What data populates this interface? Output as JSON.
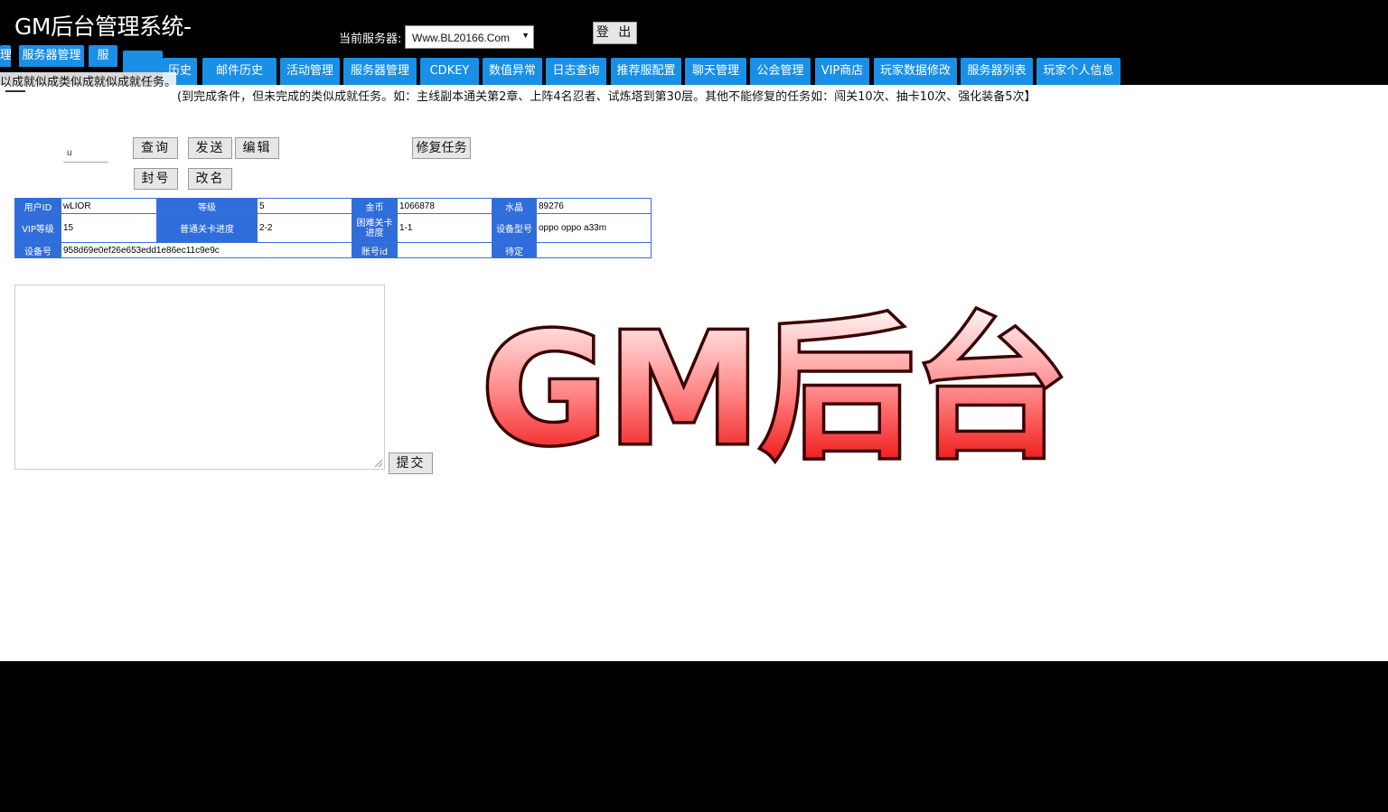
{
  "header": {
    "title": "GM后台管理系统-",
    "server_label": "当前服务器:",
    "server_selected": "Www.BL20166.Com",
    "logout_label": "登 出"
  },
  "nav": {
    "back_tabs": [
      "理",
      "服务器管理",
      "服"
    ],
    "tabs": [
      "历史",
      "邮件历史",
      "活动管理",
      "服务器管理",
      "CDKEY",
      "数值异常",
      "日志查询",
      "推荐服配置",
      "聊天管理",
      "公会管理",
      "VIP商店",
      "玩家数据修改",
      "服务器列表",
      "玩家个人信息"
    ]
  },
  "main": {
    "overflow_text": "以成就似成类似成就似成就任务。",
    "note": "(到完成条件，但未完成的类似成就任务。如：主线副本通关第2章、上阵4名忍者、试炼塔到第30层。其他不能修复的任务如：闯关10次、抽卡10次、强化装备5次】",
    "uid_value": "u",
    "buttons": {
      "query": "查询",
      "send": "发送",
      "edit": "编辑",
      "repair": "修复任务",
      "ban": "封号",
      "rename": "改名",
      "submit": "提交"
    },
    "info_table": {
      "row1": {
        "h1": "用户ID",
        "v1": "wLIOR",
        "h2": "等级",
        "v2": "5",
        "h3": "金币",
        "v3": "1066878",
        "h4": "水晶",
        "v4": "89276"
      },
      "row2": {
        "h1": "VIP等级",
        "v1": "15",
        "h2": "普通关卡进度",
        "v2": "2-2",
        "h3": "困难关卡进度",
        "v3": "1-1",
        "h4": "设备型号",
        "v4": "oppo oppo a33m"
      },
      "row3": {
        "h1": "设备号",
        "v1": "958d69e0ef26e653edd1e86ec11c9e9c",
        "h3": "账号id",
        "v3": "",
        "h4": "待定",
        "v4": ""
      }
    },
    "watermark": "GM后台"
  }
}
